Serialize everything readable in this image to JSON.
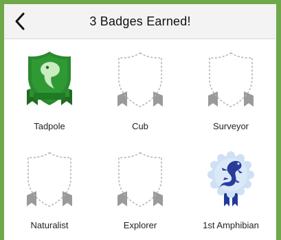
{
  "header": {
    "title": "3 Badges Earned!"
  },
  "badges": [
    {
      "label": "Tadpole",
      "earned": true,
      "icon": "tadpole-shield-icon",
      "color": "#2e8b2e"
    },
    {
      "label": "Cub",
      "earned": false,
      "icon": "locked-shield-icon"
    },
    {
      "label": "Surveyor",
      "earned": false,
      "icon": "locked-shield-icon"
    },
    {
      "label": "Naturalist",
      "earned": false,
      "icon": "locked-shield-icon"
    },
    {
      "label": "Explorer",
      "earned": false,
      "icon": "locked-shield-icon"
    },
    {
      "label": "1st Amphibian",
      "earned": true,
      "icon": "amphibian-rosette-icon",
      "color": "#2a3c9a"
    }
  ],
  "colors": {
    "frame": "#6fa84a",
    "header_bg": "#f3f3f3",
    "locked_outline": "#b5b5b5",
    "locked_ribbon": "#9a9a9a"
  }
}
